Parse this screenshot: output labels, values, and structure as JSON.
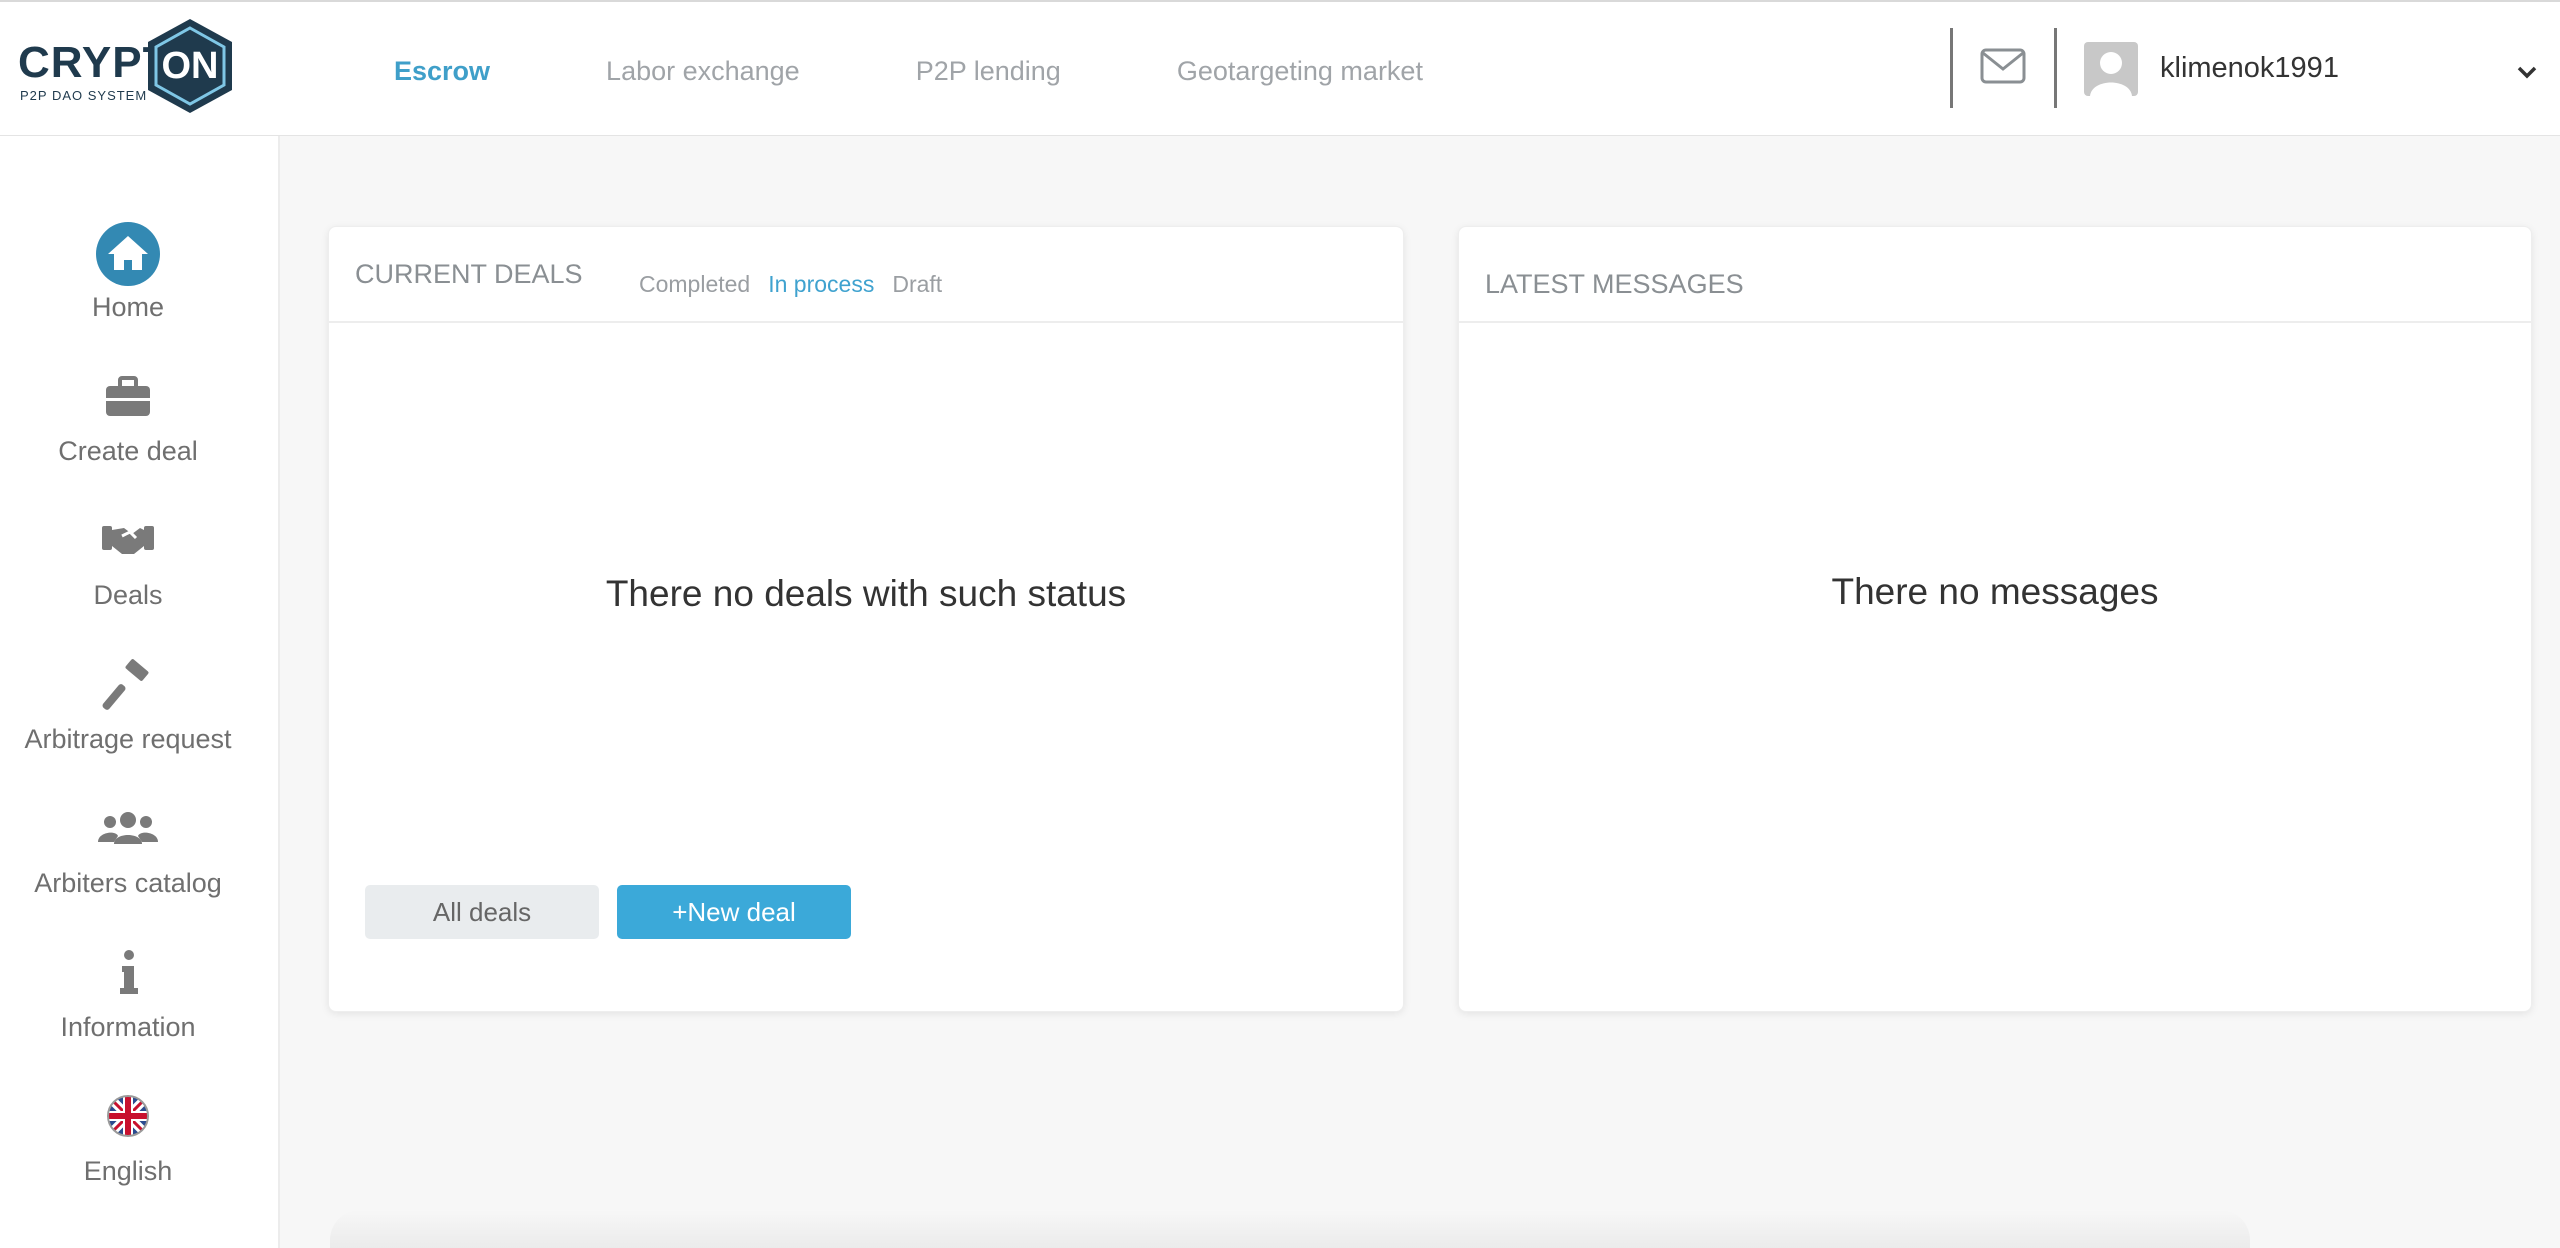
{
  "brand": {
    "word": "CRYPT",
    "badge": "ON",
    "subtitle": "P2P DAO SYSTEM"
  },
  "nav": {
    "items": [
      {
        "label": "Escrow",
        "active": true
      },
      {
        "label": "Labor exchange",
        "active": false
      },
      {
        "label": "P2P lending",
        "active": false
      },
      {
        "label": "Geotargeting market",
        "active": false
      }
    ]
  },
  "user": {
    "name": "klimenok1991"
  },
  "sidebar": {
    "items": [
      {
        "label": "Home",
        "icon": "home-icon"
      },
      {
        "label": "Create deal",
        "icon": "briefcase-icon"
      },
      {
        "label": "Deals",
        "icon": "handshake-icon"
      },
      {
        "label": "Arbitrage request",
        "icon": "gavel-icon"
      },
      {
        "label": "Arbiters catalog",
        "icon": "users-icon"
      },
      {
        "label": "Information",
        "icon": "info-icon"
      },
      {
        "label": "English",
        "icon": "uk-flag-icon"
      }
    ]
  },
  "deals": {
    "title": "CURRENT DEALS",
    "tabs": [
      {
        "label": "Completed",
        "active": false
      },
      {
        "label": "In process",
        "active": true
      },
      {
        "label": "Draft",
        "active": false
      }
    ],
    "empty": "There no deals with such status",
    "all_label": "All deals",
    "new_label": "+New deal"
  },
  "messages": {
    "title": "LATEST MESSAGES",
    "empty": "There no messages"
  },
  "colors": {
    "accent": "#3fa2cf",
    "button": "#3ba9d9",
    "brand_dark": "#1f3a4d"
  }
}
